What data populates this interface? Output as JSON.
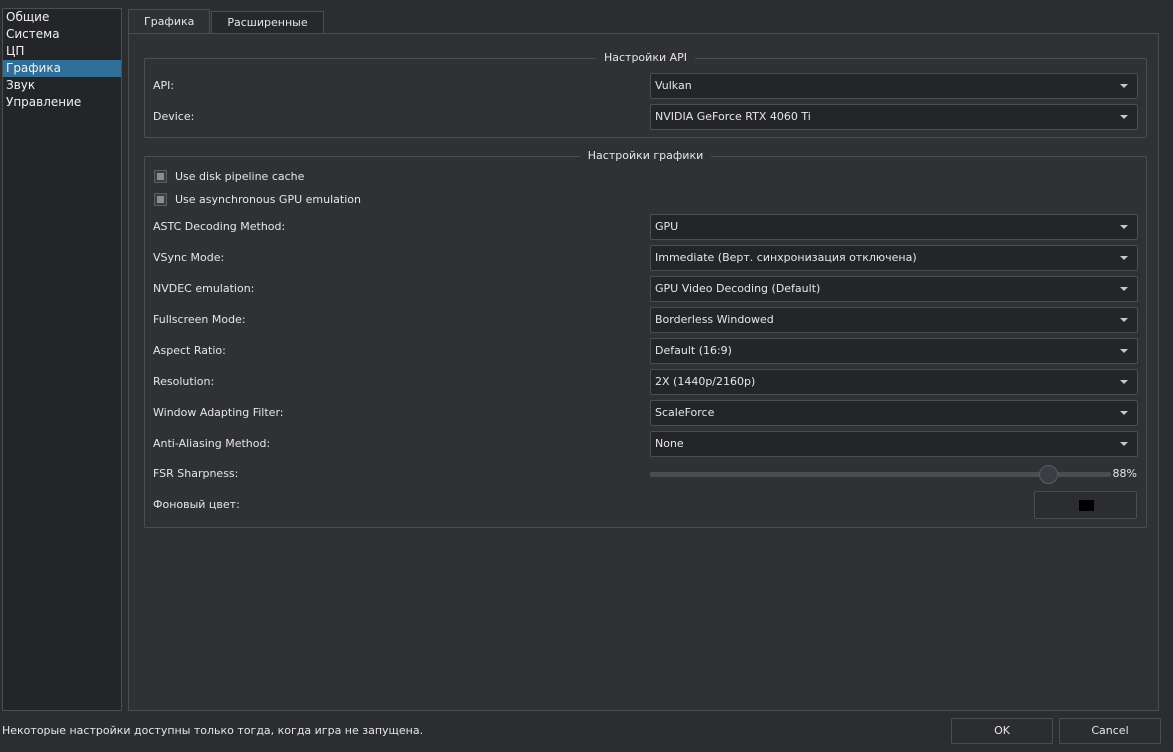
{
  "sidebar": {
    "items": [
      {
        "label": "Общие"
      },
      {
        "label": "Система"
      },
      {
        "label": "ЦП"
      },
      {
        "label": "Графика"
      },
      {
        "label": "Звук"
      },
      {
        "label": "Управление"
      }
    ],
    "selected": "Графика"
  },
  "tabs": [
    {
      "label": "Графика"
    },
    {
      "label": "Расширенные"
    }
  ],
  "api_group": {
    "title": "Настройки API",
    "api": {
      "label": "API:",
      "value": "Vulkan"
    },
    "device": {
      "label": "Device:",
      "value": "NVIDIA GeForce RTX 4060 Ti"
    }
  },
  "graphics_group": {
    "title": "Настройки графики",
    "disk_cache": {
      "label": "Use disk pipeline cache"
    },
    "async_gpu": {
      "label": "Use asynchronous GPU emulation"
    },
    "astc": {
      "label": "ASTC Decoding Method:",
      "value": "GPU"
    },
    "vsync": {
      "label": "VSync Mode:",
      "value": "Immediate (Верт. синхронизация отключена)"
    },
    "nvdec": {
      "label": "NVDEC emulation:",
      "value": "GPU Video Decoding (Default)"
    },
    "fullscreen": {
      "label": "Fullscreen Mode:",
      "value": "Borderless Windowed"
    },
    "aspect": {
      "label": "Aspect Ratio:",
      "value": "Default (16:9)"
    },
    "resolution": {
      "label": "Resolution:",
      "value": "2X (1440p/2160p)"
    },
    "filter": {
      "label": "Window Adapting Filter:",
      "value": "ScaleForce"
    },
    "aa": {
      "label": "Anti-Aliasing Method:",
      "value": "None"
    },
    "fsr": {
      "label": "FSR Sharpness:",
      "value_text": "88%",
      "value": 0.88
    },
    "bg_color": {
      "label": "Фоновый цвет:",
      "color": "#000000"
    }
  },
  "footer": {
    "note": "Некоторые настройки доступны только тогда, когда игра не запущена.",
    "ok": "OK",
    "cancel": "Cancel"
  },
  "colors": {
    "accent": "#2f6f98",
    "background": "#2b2d30"
  }
}
